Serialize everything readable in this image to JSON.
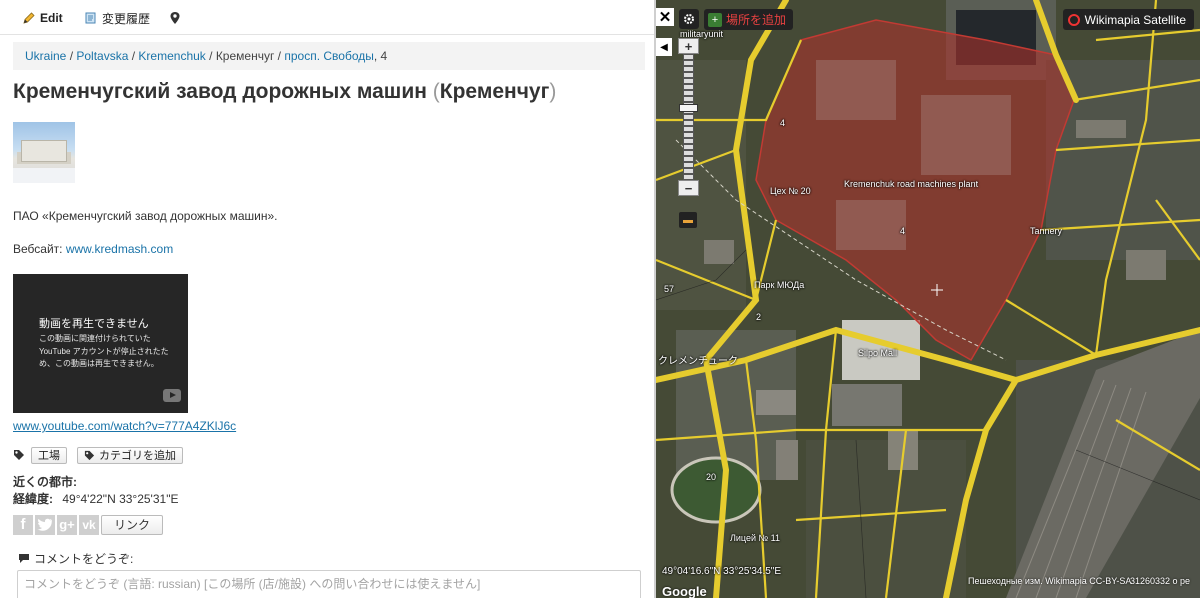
{
  "toolbar": {
    "edit_label": "Edit",
    "history_label": "変更履歴"
  },
  "breadcrumb": {
    "items": [
      "Ukraine",
      "Poltavska",
      "Kremenchuk",
      "Кременчуг",
      "просп. Свободы"
    ],
    "house_number": "4"
  },
  "title": {
    "main": "Кременчугский завод дорожных машин",
    "paren_open": "(",
    "city": "Кременчуг",
    "paren_close": ")"
  },
  "description": "ПАО «Кременчугский завод дорожных машин».",
  "website": {
    "label": "Вебсайт: ",
    "url_text": "www.kredmash.com"
  },
  "video": {
    "title": "動画を再生できません",
    "message": "この動画に関連付けられていた YouTube アカウントが停止されたため、この動画は再生できません。"
  },
  "youtube_link": "www.youtube.com/watch?v=777A4ZKlJ6c",
  "tags": {
    "items": [
      "工場"
    ],
    "add_category_label": "カテゴリを追加"
  },
  "nearby": {
    "label": "近くの都市:"
  },
  "coordinates": {
    "label": "経緯度:",
    "value": "49°4'22\"N 33°25'31\"E"
  },
  "share": {
    "networks": [
      "f",
      "t",
      "g+",
      "vk"
    ],
    "link_label": "リンク"
  },
  "comment": {
    "label": "コメントをどうぞ:",
    "placeholder": "コメントをどうぞ (言語: russian) [この場所 (店/施設) への問い合わせには使えません]"
  },
  "map": {
    "add_place_label": "場所を追加",
    "layer_label": "Wikimapia Satellite",
    "close_symbol": "✕",
    "collapse_symbol": "◀",
    "zoom_in": "+",
    "zoom_out": "−",
    "labels": {
      "military": "militaryunit",
      "plant": "Kremenchuk road machines plant",
      "workshop": "Цех № 20",
      "tannery": "Tannery",
      "park": "Парк МЮДа",
      "mall": "Silpo Mall",
      "city": "クレメンチューク",
      "lyceum": "Лицей № 11"
    },
    "polygon_numbers": [
      "4",
      "4",
      "2",
      "20",
      "57"
    ],
    "coords_readout": "49°04'16.6\"N 33°25'34.5\"E",
    "license": "Пешеходные изм. Wikimapia CC-BY-SA",
    "object_count": "31260332 о ре",
    "google": "Google",
    "colors": {
      "polygon_fill": "#b2312b",
      "road": "#e6cc2e",
      "satellite": "#3d4130"
    }
  }
}
